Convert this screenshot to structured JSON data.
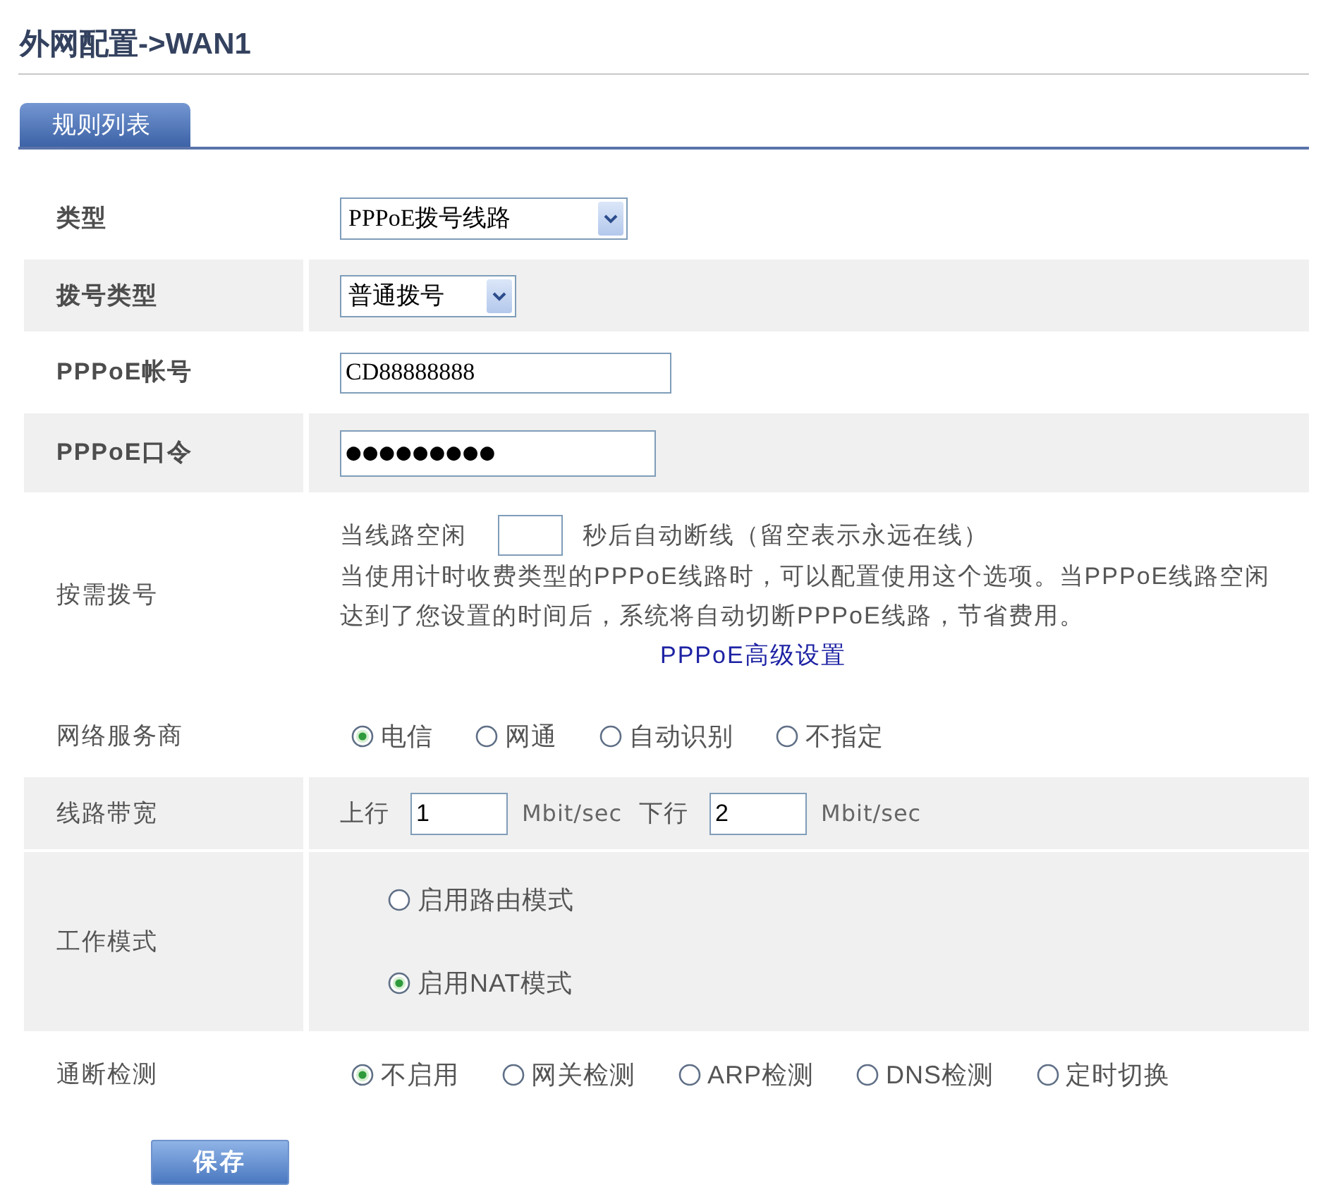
{
  "page_title": "外网配置->WAN1",
  "tabs": [
    {
      "label": "规则列表",
      "selected": true
    }
  ],
  "form_rows": [
    {
      "kind": "select",
      "label": "类型",
      "bold": true,
      "shaded": false,
      "value": "PPPoE拨号线路"
    },
    {
      "kind": "select",
      "label": "拨号类型",
      "bold": true,
      "shaded": true,
      "value": "普通拨号"
    },
    {
      "kind": "text",
      "label": "PPPoE帐号",
      "bold": true,
      "shaded": false,
      "value": "CD88888888"
    },
    {
      "kind": "password",
      "label": "PPPoE口令",
      "bold": true,
      "shaded": true,
      "value": "●●●●●●●●●"
    },
    {
      "kind": "on_demand",
      "label": "按需拨号",
      "bold": false,
      "shaded": false,
      "prefix": "当线路空闲",
      "suffix": "秒后自动断线（留空表示永远在线）",
      "description": "当使用计时收费类型的PPPoE线路时，可以配置使用这个选项。当PPPoE线路空闲达到了您设置的时间后，系统将自动切断PPPoE线路，节省费用。",
      "link": "PPPoE高级设置"
    },
    {
      "kind": "radio_row",
      "label": "网络服务商",
      "bold": false,
      "shaded": false,
      "options": [
        {
          "label": "电信",
          "selected": true
        },
        {
          "label": "网通",
          "selected": false
        },
        {
          "label": "自动识别",
          "selected": false
        },
        {
          "label": "不指定",
          "selected": false
        }
      ]
    },
    {
      "kind": "bandwidth",
      "label": "线路带宽",
      "bold": false,
      "shaded": true,
      "fields": [
        {
          "label": "上行",
          "value": "1",
          "unit": "Mbit/sec"
        },
        {
          "label": "下行",
          "value": "2",
          "unit": "Mbit/sec"
        }
      ]
    },
    {
      "kind": "radio_column",
      "label": "工作模式",
      "bold": false,
      "shaded": true,
      "options": [
        {
          "label": "启用路由模式",
          "selected": false
        },
        {
          "label": "启用NAT模式",
          "selected": true
        }
      ]
    },
    {
      "kind": "radio_row",
      "label": "通断检测",
      "bold": false,
      "shaded": false,
      "options": [
        {
          "label": "不启用",
          "selected": true
        },
        {
          "label": "网关检测",
          "selected": false
        },
        {
          "label": "ARP检测",
          "selected": false
        },
        {
          "label": "DNS检测",
          "selected": false
        },
        {
          "label": "定时切换",
          "selected": false
        }
      ]
    }
  ],
  "buttons": [
    {
      "label": "保存"
    }
  ]
}
